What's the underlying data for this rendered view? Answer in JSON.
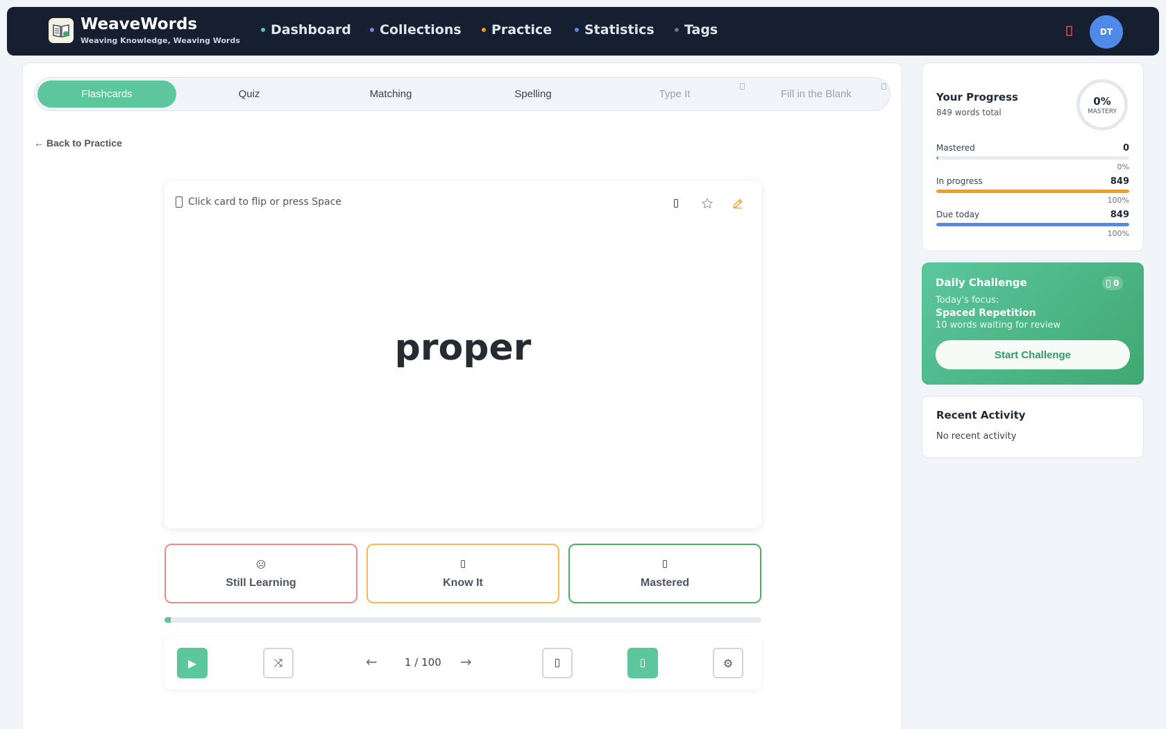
{
  "header": {
    "brand_name": "WeaveWords",
    "tagline": "Weaving Knowledge, Weaving Words",
    "nav": [
      {
        "label": "Dashboard",
        "dot_color": "#5cc69d"
      },
      {
        "label": "Collections",
        "dot_color": "#8b7be0"
      },
      {
        "label": "Practice",
        "dot_color": "#f59e1b"
      },
      {
        "label": "Statistics",
        "dot_color": "#4f8ae8"
      },
      {
        "label": "Tags",
        "dot_color": "#6b7280"
      }
    ],
    "avatar_initials": "DT"
  },
  "modes": {
    "tabs": [
      {
        "label": "Flashcards",
        "state": "active"
      },
      {
        "label": "Quiz",
        "state": "normal"
      },
      {
        "label": "Matching",
        "state": "normal"
      },
      {
        "label": "Spelling",
        "state": "normal"
      },
      {
        "label": "Type It",
        "state": "locked"
      },
      {
        "label": "Fill in the Blank",
        "state": "locked"
      }
    ]
  },
  "back_link": "← Back to Practice",
  "card": {
    "hint": "Click card to flip or press Space",
    "word": "proper"
  },
  "ratings": [
    {
      "label": "Still Learning",
      "icon": "☹",
      "color": "#f08a8a"
    },
    {
      "label": "Know It",
      "icon": "",
      "color": "#f9b74d"
    },
    {
      "label": "Mastered",
      "icon": "",
      "color": "#4caf60"
    }
  ],
  "session": {
    "current": 1,
    "total": 100,
    "counter_text": "1 / 100",
    "prev_arrow": "←",
    "next_arrow": "→",
    "play_icon": "▶",
    "shuffle_icon": "⤨",
    "settings_icon": "⚙"
  },
  "progress": {
    "title": "Your Progress",
    "subtitle": "849 words total",
    "mastery_pct": "0%",
    "mastery_label": "MASTERY",
    "stats": [
      {
        "label": "Mastered",
        "value": "0",
        "pct": "0%",
        "fraction": 0.01,
        "color": "#5cc69d"
      },
      {
        "label": "In progress",
        "value": "849",
        "pct": "100%",
        "fraction": 1.0,
        "color": "#f59e1b"
      },
      {
        "label": "Due today",
        "value": "849",
        "pct": "100%",
        "fraction": 1.0,
        "color": "#4f8ae8"
      }
    ]
  },
  "challenge": {
    "title": "Daily Challenge",
    "streak": "0",
    "focus_label": "Today's focus:",
    "focus_topic": "Spaced Repetition",
    "description": "10 words waiting for review",
    "button": "Start Challenge"
  },
  "activity": {
    "title": "Recent Activity",
    "empty": "No recent activity"
  }
}
